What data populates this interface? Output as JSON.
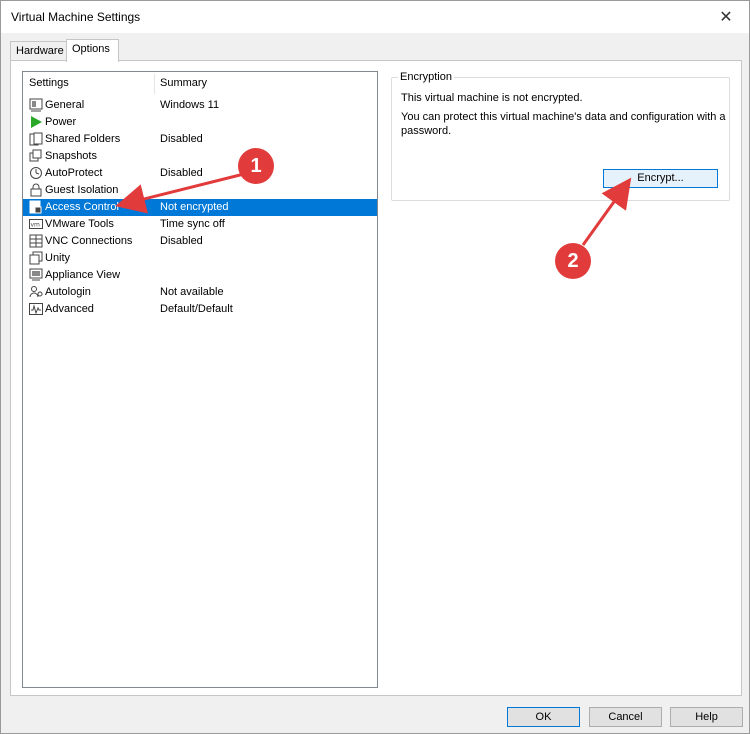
{
  "window": {
    "title": "Virtual Machine Settings"
  },
  "tabs": [
    {
      "label": "Hardware"
    },
    {
      "label": "Options"
    }
  ],
  "settings_list": {
    "columns": {
      "settings": "Settings",
      "summary": "Summary"
    },
    "items": [
      {
        "name": "General",
        "summary": "Windows 11",
        "icon": "general-icon"
      },
      {
        "name": "Power",
        "summary": "",
        "icon": "power-icon"
      },
      {
        "name": "Shared Folders",
        "summary": "Disabled",
        "icon": "shared-folders-icon"
      },
      {
        "name": "Snapshots",
        "summary": "",
        "icon": "snapshots-icon"
      },
      {
        "name": "AutoProtect",
        "summary": "Disabled",
        "icon": "autoprotect-icon"
      },
      {
        "name": "Guest Isolation",
        "summary": "",
        "icon": "lock-icon"
      },
      {
        "name": "Access Control",
        "summary": "Not encrypted",
        "icon": "access-control-icon",
        "selected": true
      },
      {
        "name": "VMware Tools",
        "summary": "Time sync off",
        "icon": "vmware-tools-icon"
      },
      {
        "name": "VNC Connections",
        "summary": "Disabled",
        "icon": "vnc-icon"
      },
      {
        "name": "Unity",
        "summary": "",
        "icon": "unity-icon"
      },
      {
        "name": "Appliance View",
        "summary": "",
        "icon": "appliance-view-icon"
      },
      {
        "name": "Autologin",
        "summary": "Not available",
        "icon": "autologin-icon"
      },
      {
        "name": "Advanced",
        "summary": "Default/Default",
        "icon": "advanced-icon"
      }
    ]
  },
  "encryption": {
    "legend": "Encryption",
    "status": "This virtual machine is not encrypted.",
    "description": "You can protect this virtual machine's data and configuration with a password.",
    "encrypt_button": "Encrypt..."
  },
  "footer": {
    "ok": "OK",
    "cancel": "Cancel",
    "help": "Help"
  },
  "annotations": [
    {
      "label": "1"
    },
    {
      "label": "2"
    }
  ],
  "colors": {
    "selection": "#0078d7",
    "annotation": "#e23b3b",
    "power": "#2aa82a"
  }
}
